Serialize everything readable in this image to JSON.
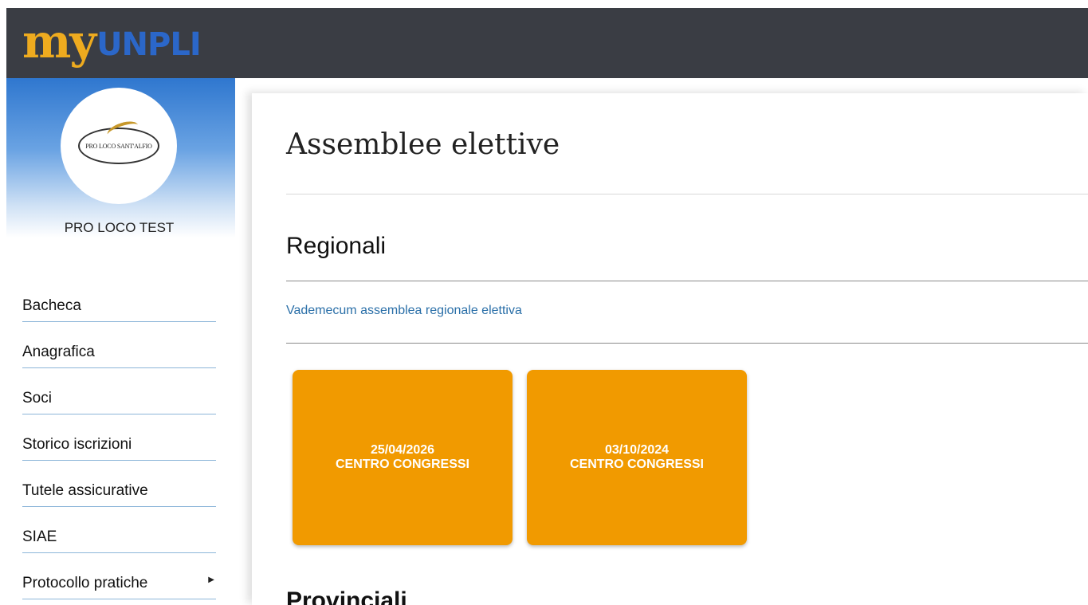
{
  "header": {
    "logo_my": "my",
    "logo_unpli": "UNPLI"
  },
  "sidebar": {
    "seal_text": "PRO LOCO SANT'ALFIO",
    "org_name": "PRO LOCO TEST",
    "items": [
      {
        "label": "Bacheca"
      },
      {
        "label": "Anagrafica"
      },
      {
        "label": "Soci"
      },
      {
        "label": "Storico iscrizioni"
      },
      {
        "label": "Tutele assicurative"
      },
      {
        "label": "SIAE"
      },
      {
        "label": "Protocollo pratiche",
        "has_submenu": true
      }
    ]
  },
  "main": {
    "title": "Assemblee elettive",
    "sections": [
      {
        "title": "Regionali",
        "link": "Vademecum assemblea regionale elettiva",
        "cards": [
          {
            "date": "25/04/2026",
            "place": "CENTRO CONGRESSI"
          },
          {
            "date": "03/10/2024",
            "place": "CENTRO CONGRESSI"
          }
        ]
      },
      {
        "title": "Provinciali"
      }
    ]
  },
  "colors": {
    "header_bg": "#3a3d44",
    "logo_my": "#eeab1f",
    "logo_unpli": "#2b67c9",
    "card_bg": "#f19a00",
    "link": "#2a6fa8",
    "nav_divider": "#8db6d9"
  }
}
